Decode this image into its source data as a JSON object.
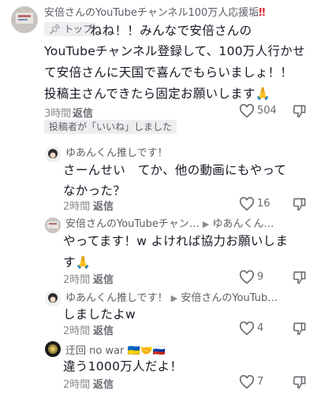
{
  "pinned_comment": {
    "username": "安倍さんのYouTubeチャンネル100万人応援垢",
    "username_suffix": "‼",
    "pin_label": "トップ",
    "text_line1": "ねね！！みんなで安倍さんの",
    "text_line2": "YouTubeチャンネル登録して、100万人行かせ",
    "text_line3": "て安倍さんに天国で喜んでもらいましょ！！",
    "text_line4": "投稿主さんできたら固定お願いします🙏",
    "time": "3時間",
    "reply_label": "返信",
    "like_count": "504",
    "liked_by_creator": "投稿者が「いいね」しました"
  },
  "replies": [
    {
      "username": "ゆあんくん推しです！",
      "lines": [
        "さーんせい　てか、他の動画にもやって",
        "なかった？"
      ],
      "time": "2時間",
      "reply_label": "返信",
      "like_count": "16"
    },
    {
      "username": "安倍さんのYouTubeチャン…",
      "reply_to": "ゆあんくん…",
      "lines": [
        "やってます！w よければ協力お願いしま",
        "す🙏"
      ],
      "time": "2時間",
      "reply_label": "返信",
      "like_count": "9"
    },
    {
      "username": "ゆあんくん推しです！",
      "reply_to": "安倍さんのYouTub…",
      "lines": [
        "しましたよw"
      ],
      "time": "2時間",
      "reply_label": "返信",
      "like_count": "4"
    },
    {
      "username": "迂回 no war 🇺🇦🤝🇷🇺",
      "lines": [
        "違う1000万人だよ！"
      ],
      "time": "2時間",
      "reply_label": "返信",
      "like_count": "7"
    }
  ],
  "icons": {
    "like": "heart-outline-icon",
    "dislike": "thumbs-down-icon",
    "pin": "pin-icon",
    "reply_arrow": "triangle-right-icon"
  },
  "colors": {
    "text": "#161823",
    "muted": "#8a8b91",
    "alert": "#e0242f"
  }
}
